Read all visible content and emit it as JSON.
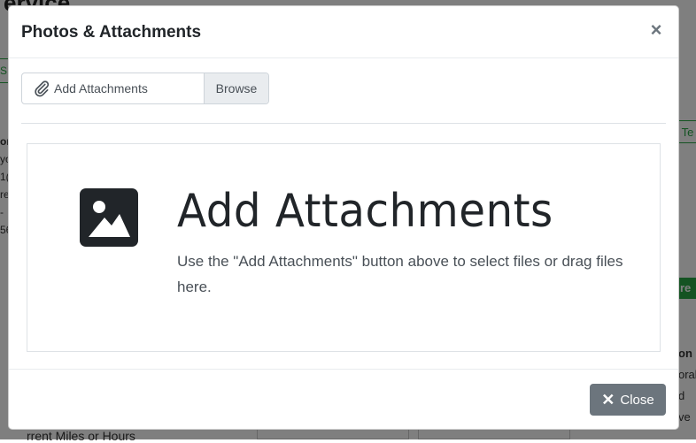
{
  "background": {
    "title": "ervice",
    "tab_left": "S",
    "right_button": "n Te",
    "green_badge": "gre",
    "left_col": [
      "",
      "or",
      "yo",
      "1(",
      "re",
      "-",
      "56"
    ],
    "bottom_text": "rrent Miles or Hours",
    "right_col": [
      "on",
      "",
      "orak",
      "d",
      "ve"
    ]
  },
  "modal": {
    "title": "Photos & Attachments",
    "close_symbol": "×",
    "file_input": {
      "label": "Add Attachments",
      "browse": "Browse"
    },
    "dropzone": {
      "heading": "Add Attachments",
      "instructions": "Use the \"Add Attachments\" button above to select files or drag files here."
    },
    "footer": {
      "close_symbol": "✕",
      "close_label": "Close"
    }
  },
  "colors": {
    "overlay": "rgba(0,0,0,0.5)",
    "secondary_button": "#6c757d",
    "icon_dark": "#212529",
    "success_green": "#28a745"
  }
}
